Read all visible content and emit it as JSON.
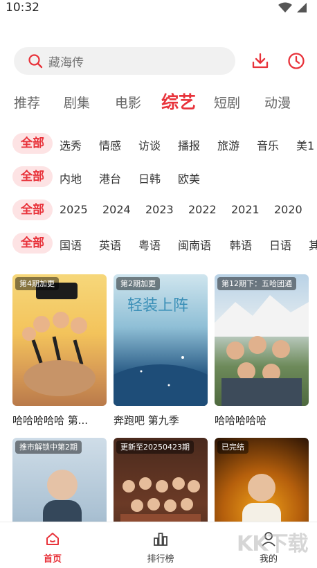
{
  "status": {
    "time": "10:32"
  },
  "search": {
    "placeholder": "藏海传"
  },
  "categories": [
    {
      "label": "推荐",
      "active": false
    },
    {
      "label": "剧集",
      "active": false
    },
    {
      "label": "电影",
      "active": false
    },
    {
      "label": "综艺",
      "active": true
    },
    {
      "label": "短剧",
      "active": false
    },
    {
      "label": "动漫",
      "active": false
    }
  ],
  "filters": [
    {
      "all": "全部",
      "options": [
        "选秀",
        "情感",
        "访谈",
        "播报",
        "旅游",
        "音乐",
        "美1"
      ]
    },
    {
      "all": "全部",
      "options": [
        "内地",
        "港台",
        "日韩",
        "欧美"
      ]
    },
    {
      "all": "全部",
      "options": [
        "2025",
        "2024",
        "2023",
        "2022",
        "2021",
        "2020"
      ]
    },
    {
      "all": "全部",
      "options": [
        "国语",
        "英语",
        "粤语",
        "闽南语",
        "韩语",
        "日语",
        "其"
      ]
    }
  ],
  "posters": [
    {
      "badge": "第4期加更",
      "title": "哈哈哈哈哈 第..."
    },
    {
      "badge": "第2期加更",
      "title": "奔跑吧 第九季"
    },
    {
      "badge": "第12期下：五哈团通",
      "title": "哈哈哈哈哈"
    },
    {
      "badge": "推市解锁中第2期",
      "title": ""
    },
    {
      "badge": "更新至20250423期",
      "title": ""
    },
    {
      "badge": "已完结",
      "title": ""
    }
  ],
  "nav": [
    {
      "label": "首页",
      "icon": "home-icon",
      "active": true
    },
    {
      "label": "排行榜",
      "icon": "ranking-icon",
      "active": false
    },
    {
      "label": "我的",
      "icon": "profile-icon",
      "active": false
    }
  ],
  "watermark": "KK下载",
  "colors": {
    "accent": "#e8323a",
    "chip_bg": "#fde3e4"
  }
}
